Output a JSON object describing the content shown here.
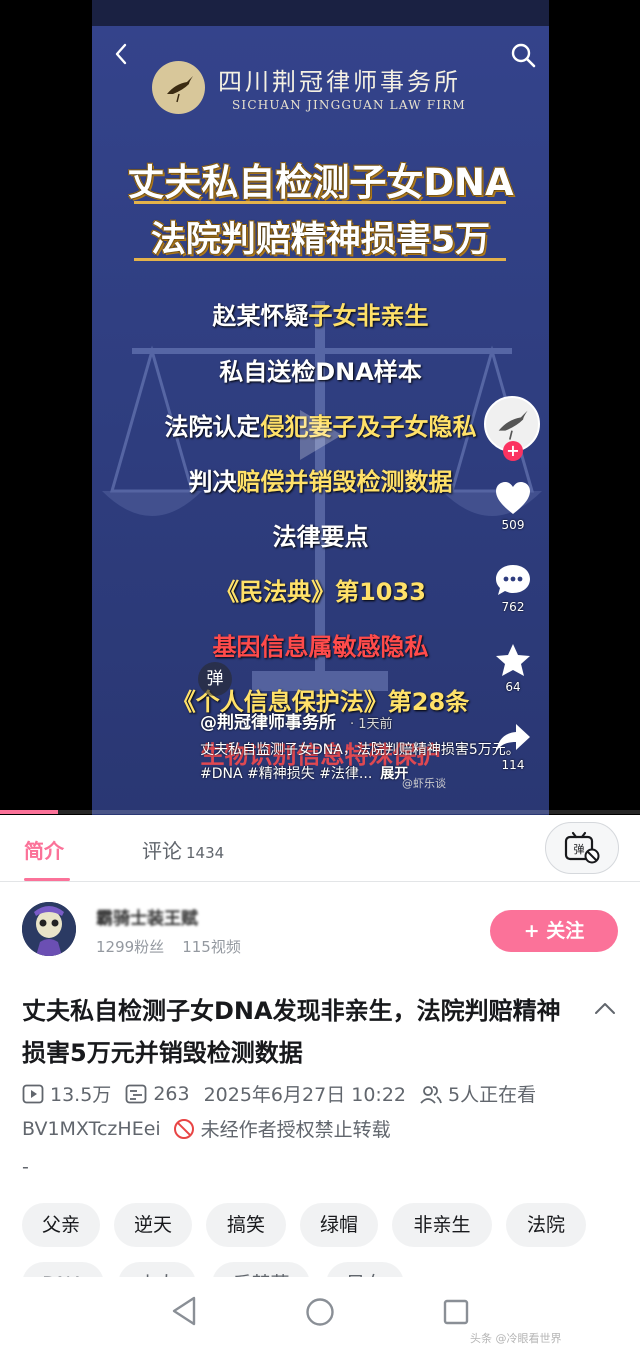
{
  "video": {
    "firm_name_cn": "四川荆冠律师事务所",
    "firm_name_en": "SICHUAN JINGGUAN LAW FIRM",
    "headline_line1": "丈夫私自检测子女DNA",
    "headline_line2": "法院判赔精神损害5万",
    "overlay": [
      {
        "plain": "赵某怀疑",
        "highlight": "子女非亲生"
      },
      {
        "plain": "私自送检DNA样本",
        "highlight": ""
      },
      {
        "plain": "法院认定",
        "highlight": "侵犯妻子及子女隐私"
      },
      {
        "plain": "判决",
        "highlight": "赔偿并销毁检测数据"
      },
      {
        "plain": "法律要点",
        "highlight": ""
      },
      {
        "plain": "",
        "highlight": "《民法典》第1033"
      },
      {
        "plain": "",
        "highlight": "基因信息属敏感隐私"
      },
      {
        "plain": "",
        "highlight": "《个人信息保护法》第28条"
      }
    ],
    "bottom_overlay_red": "生物识别信息特殊保护",
    "danmaku_badge": "弹",
    "uploader_handle": "@荆冠律师事务所",
    "post_time": "· 1天前",
    "description": "丈夫私自监测子女DNA，法院判赔精神损害5万元。#DNA #精神损失 #法律...",
    "expand_label": "展开",
    "watermark": "@虾乐谈",
    "progress_fraction": 0.09,
    "actions": {
      "likes": "509",
      "comments": "762",
      "favorites": "64",
      "shares": "114",
      "follow_plus": "+"
    }
  },
  "tabs": {
    "intro": "简介",
    "comments": "评论",
    "comments_count": "1434",
    "danmaku_toggle_icon": "danmaku-off-icon"
  },
  "uploader": {
    "name": "霸骑士装王赋",
    "fans": "1299粉丝",
    "videos": "115视频",
    "follow_label": "+ 关注"
  },
  "detail": {
    "title": "丈夫私自检测子女DNA发现非亲生，法院判赔精神损害5万元并销毁检测数据",
    "views": "13.5万",
    "danmaku_count": "263",
    "publish_time": "2025年6月27日 10:22",
    "watching": "5人正在看",
    "bvid": "BV1MXTczHEei",
    "no_repost": "未经作者授权禁止转载",
    "desc_placeholder": "-"
  },
  "tags_row1": [
    "父亲",
    "逆天",
    "搞笑",
    "绿帽",
    "非亲生",
    "法院"
  ],
  "tags_row2": [
    "DNA",
    "小人",
    "后楚藤",
    "风女"
  ],
  "colors": {
    "accent": "#fb7299",
    "video_bg": "#2f3d7f",
    "highlight_yellow": "#ffe169",
    "highlight_red": "#ff4b4b"
  },
  "bottom_watermark": "头条 @冷眼看世界"
}
